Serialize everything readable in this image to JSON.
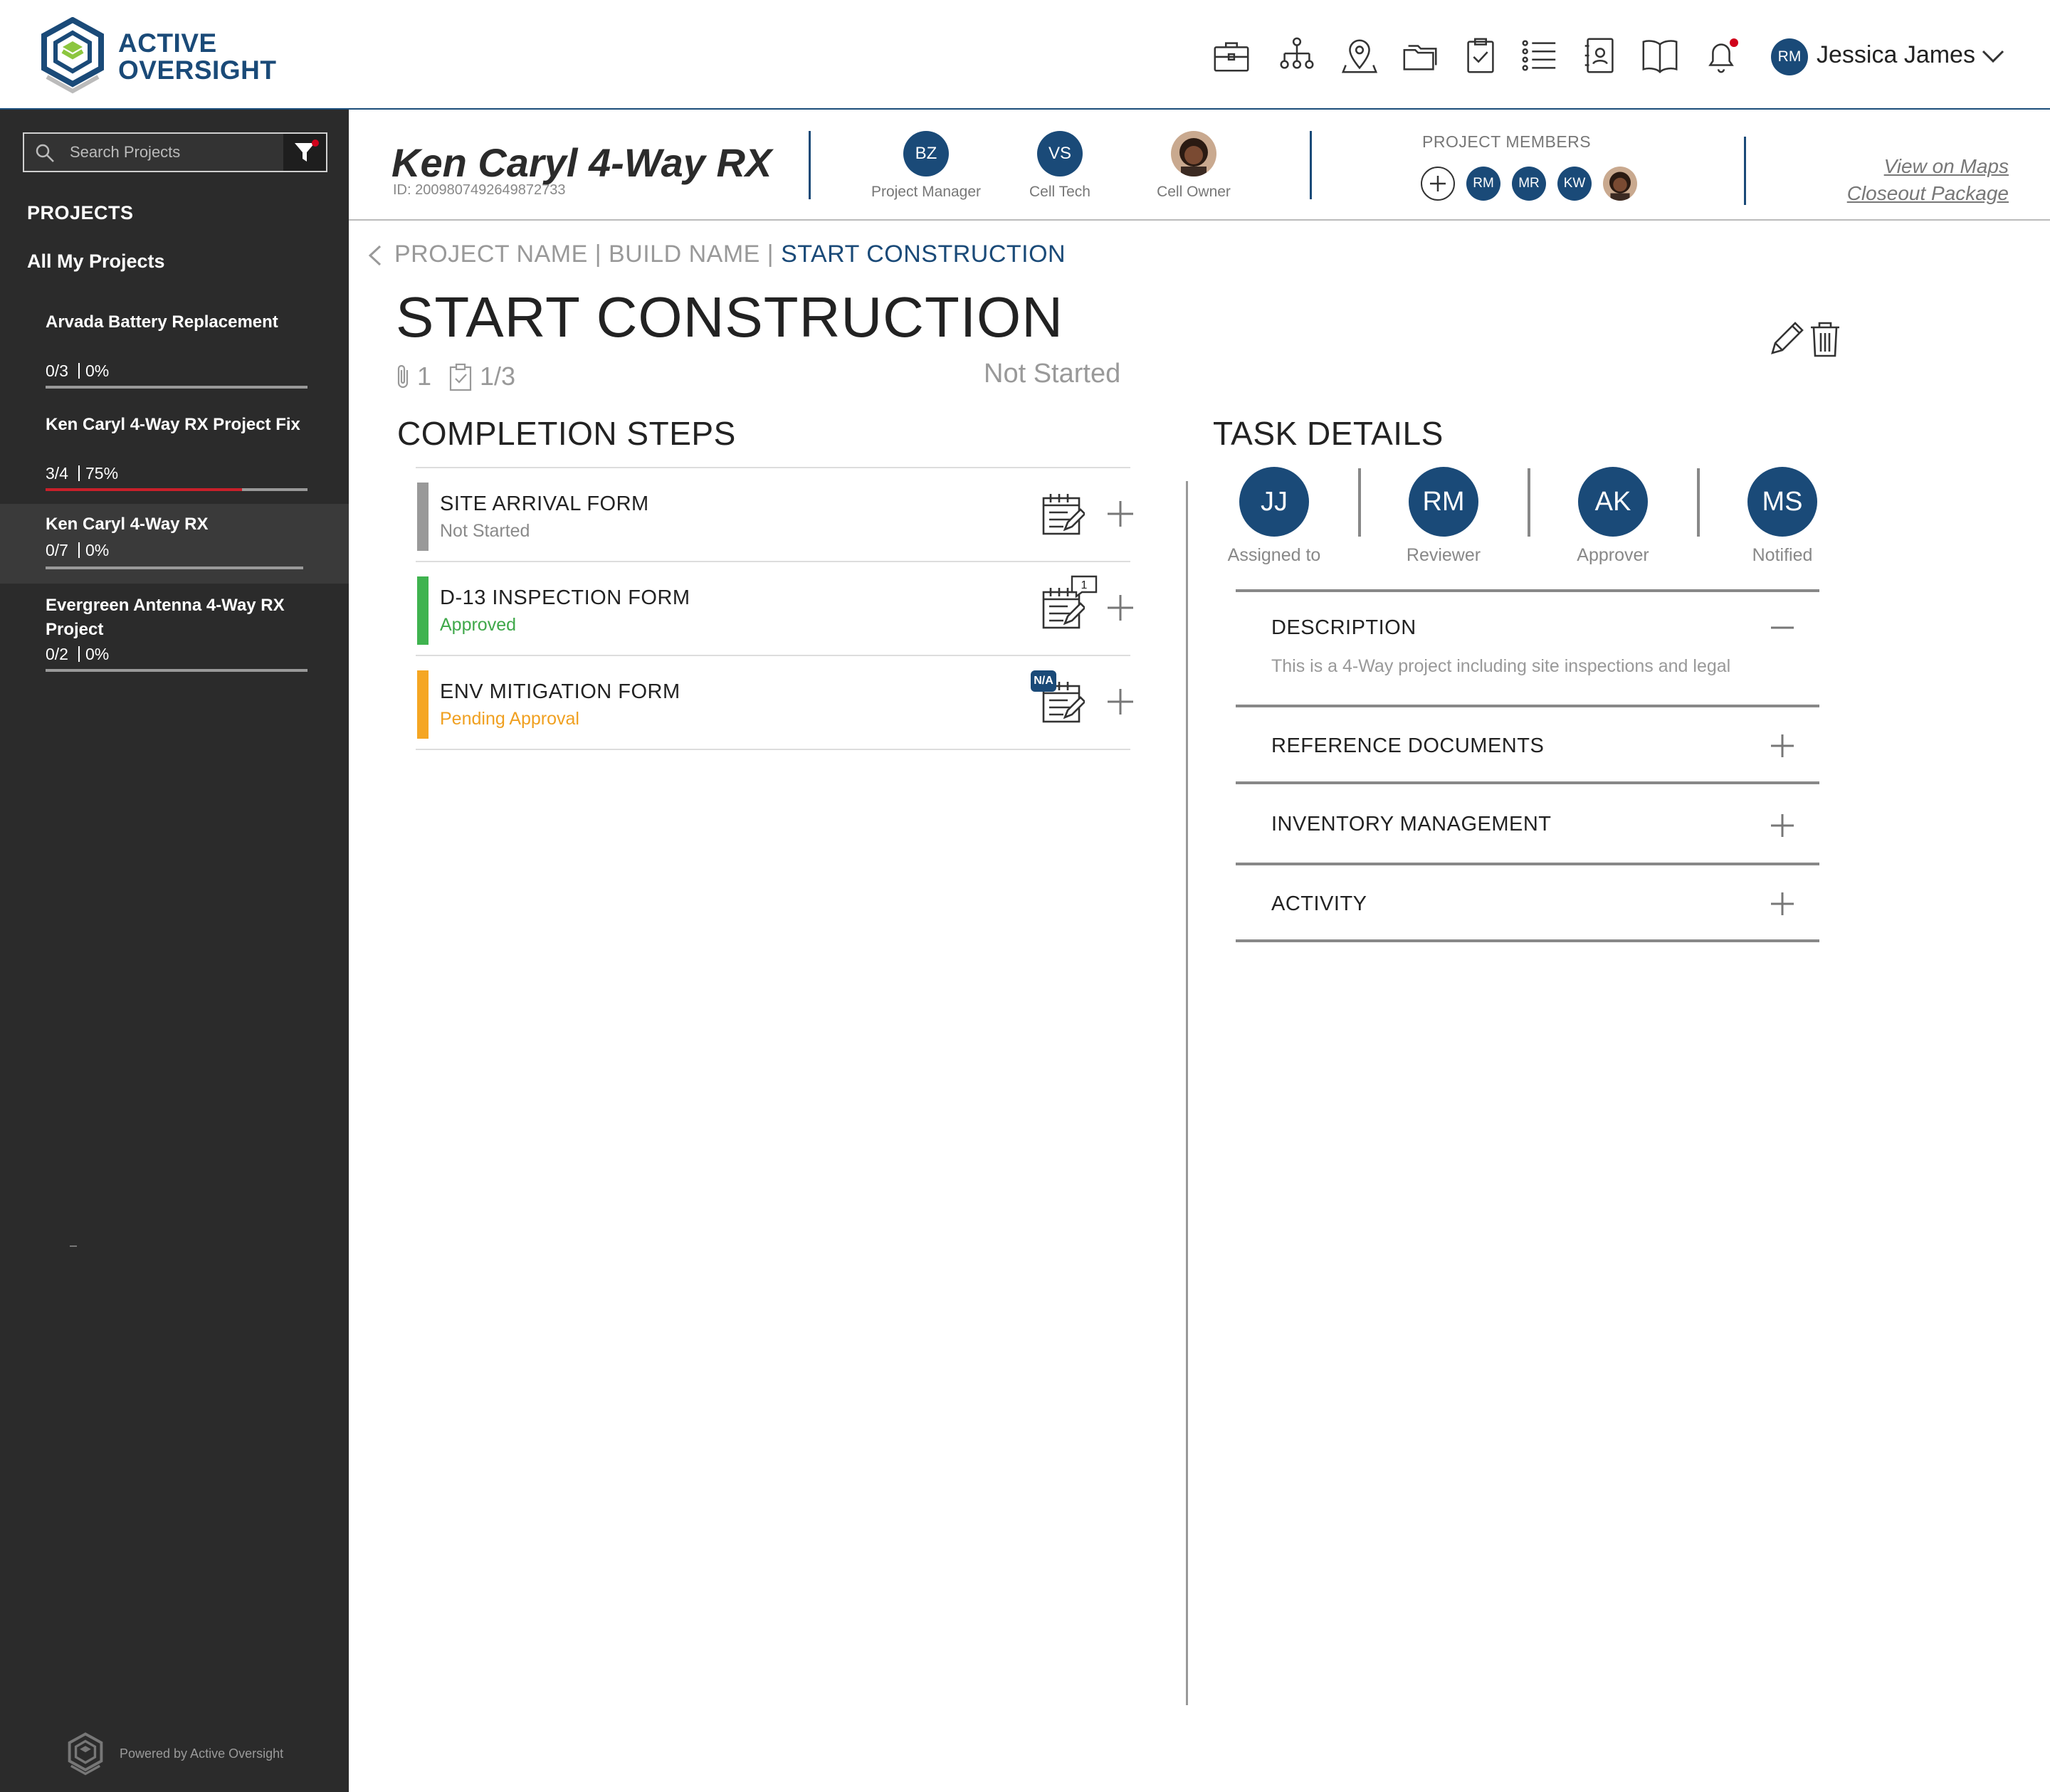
{
  "brand": {
    "line1": "ACTIVE",
    "line2": "OVERSIGHT",
    "powered_by": "Powered by Active Oversight"
  },
  "top_nav": {
    "icons": [
      "briefcase-icon",
      "org-chart-icon",
      "map-pin-icon",
      "folders-icon",
      "clipboard-check-icon",
      "list-icon",
      "contacts-book-icon",
      "open-book-icon",
      "bell-icon"
    ],
    "notification_dot": true,
    "user": {
      "initials": "RM",
      "name": "Jessica James"
    }
  },
  "sidebar": {
    "search_placeholder": "Search Projects",
    "heading": "PROJECTS",
    "all_projects": "All My Projects",
    "projects": [
      {
        "name": "Arvada Battery Replacement",
        "done": "0/3",
        "percent": "0%",
        "progress": 0.0,
        "active": false
      },
      {
        "name": "Ken Caryl 4-Way RX Project Fix",
        "done": "3/4",
        "percent": "75%",
        "progress": 0.75,
        "active": false
      },
      {
        "name": "Ken Caryl 4-Way RX",
        "done": "0/7",
        "percent": "0%",
        "progress": 0.0,
        "active": true
      },
      {
        "name": "Evergreen Antenna 4-Way RX Project",
        "done": "0/2",
        "percent": "0%",
        "progress": 0.0,
        "active": false
      }
    ]
  },
  "project": {
    "title": "Ken Caryl 4-Way RX",
    "id_label": "ID: 200980749264987​2733",
    "roles": [
      {
        "initials": "BZ",
        "label": "Project Manager"
      },
      {
        "initials": "VS",
        "label": "Cell Tech"
      },
      {
        "initials": "",
        "label": "Cell Owner",
        "photo": true
      }
    ],
    "members_label": "PROJECT MEMBERS",
    "members": [
      "RM",
      "MR",
      "KW"
    ],
    "links": {
      "maps": "View on Maps",
      "closeout": "Closeout Package"
    }
  },
  "breadcrumb": {
    "project": "PROJECT NAME",
    "sep": "|",
    "build": "BUILD NAME",
    "current": "START CONSTRUCTION"
  },
  "task": {
    "title": "START CONSTRUCTION",
    "attachments": "1",
    "checklist": "1/3",
    "status": "Not Started"
  },
  "completion": {
    "heading": "COMPLETION STEPS",
    "steps": [
      {
        "name": "SITE ARRIVAL FORM",
        "status": "Not Started",
        "color": "#999999",
        "status_color": "#8a8a8a",
        "badge": ""
      },
      {
        "name": "D-13 INSPECTION FORM",
        "status": "Approved",
        "color": "#3fb34f",
        "status_color": "#3fa84a",
        "badge": "1"
      },
      {
        "name": "ENV MITIGATION FORM",
        "status": "Pending Approval",
        "color": "#f5a623",
        "status_color": "#f0a020",
        "badge": "N/A"
      }
    ]
  },
  "details": {
    "heading": "TASK DETAILS",
    "people": [
      {
        "initials": "JJ",
        "label": "Assigned to"
      },
      {
        "initials": "RM",
        "label": "Reviewer"
      },
      {
        "initials": "AK",
        "label": "Approver"
      },
      {
        "initials": "MS",
        "label": "Notified"
      }
    ],
    "sections": [
      {
        "title": "DESCRIPTION",
        "expanded": true,
        "body": "This is a 4-Way project including site inspections and legal"
      },
      {
        "title": "REFERENCE DOCUMENTS",
        "expanded": false
      },
      {
        "title": "INVENTORY MANAGEMENT",
        "expanded": false
      },
      {
        "title": "ACTIVITY",
        "expanded": false
      }
    ]
  },
  "colors": {
    "brand_blue": "#1a4a78",
    "sidebar_bg": "#2b2b2b",
    "progress_red": "#c9202a"
  }
}
